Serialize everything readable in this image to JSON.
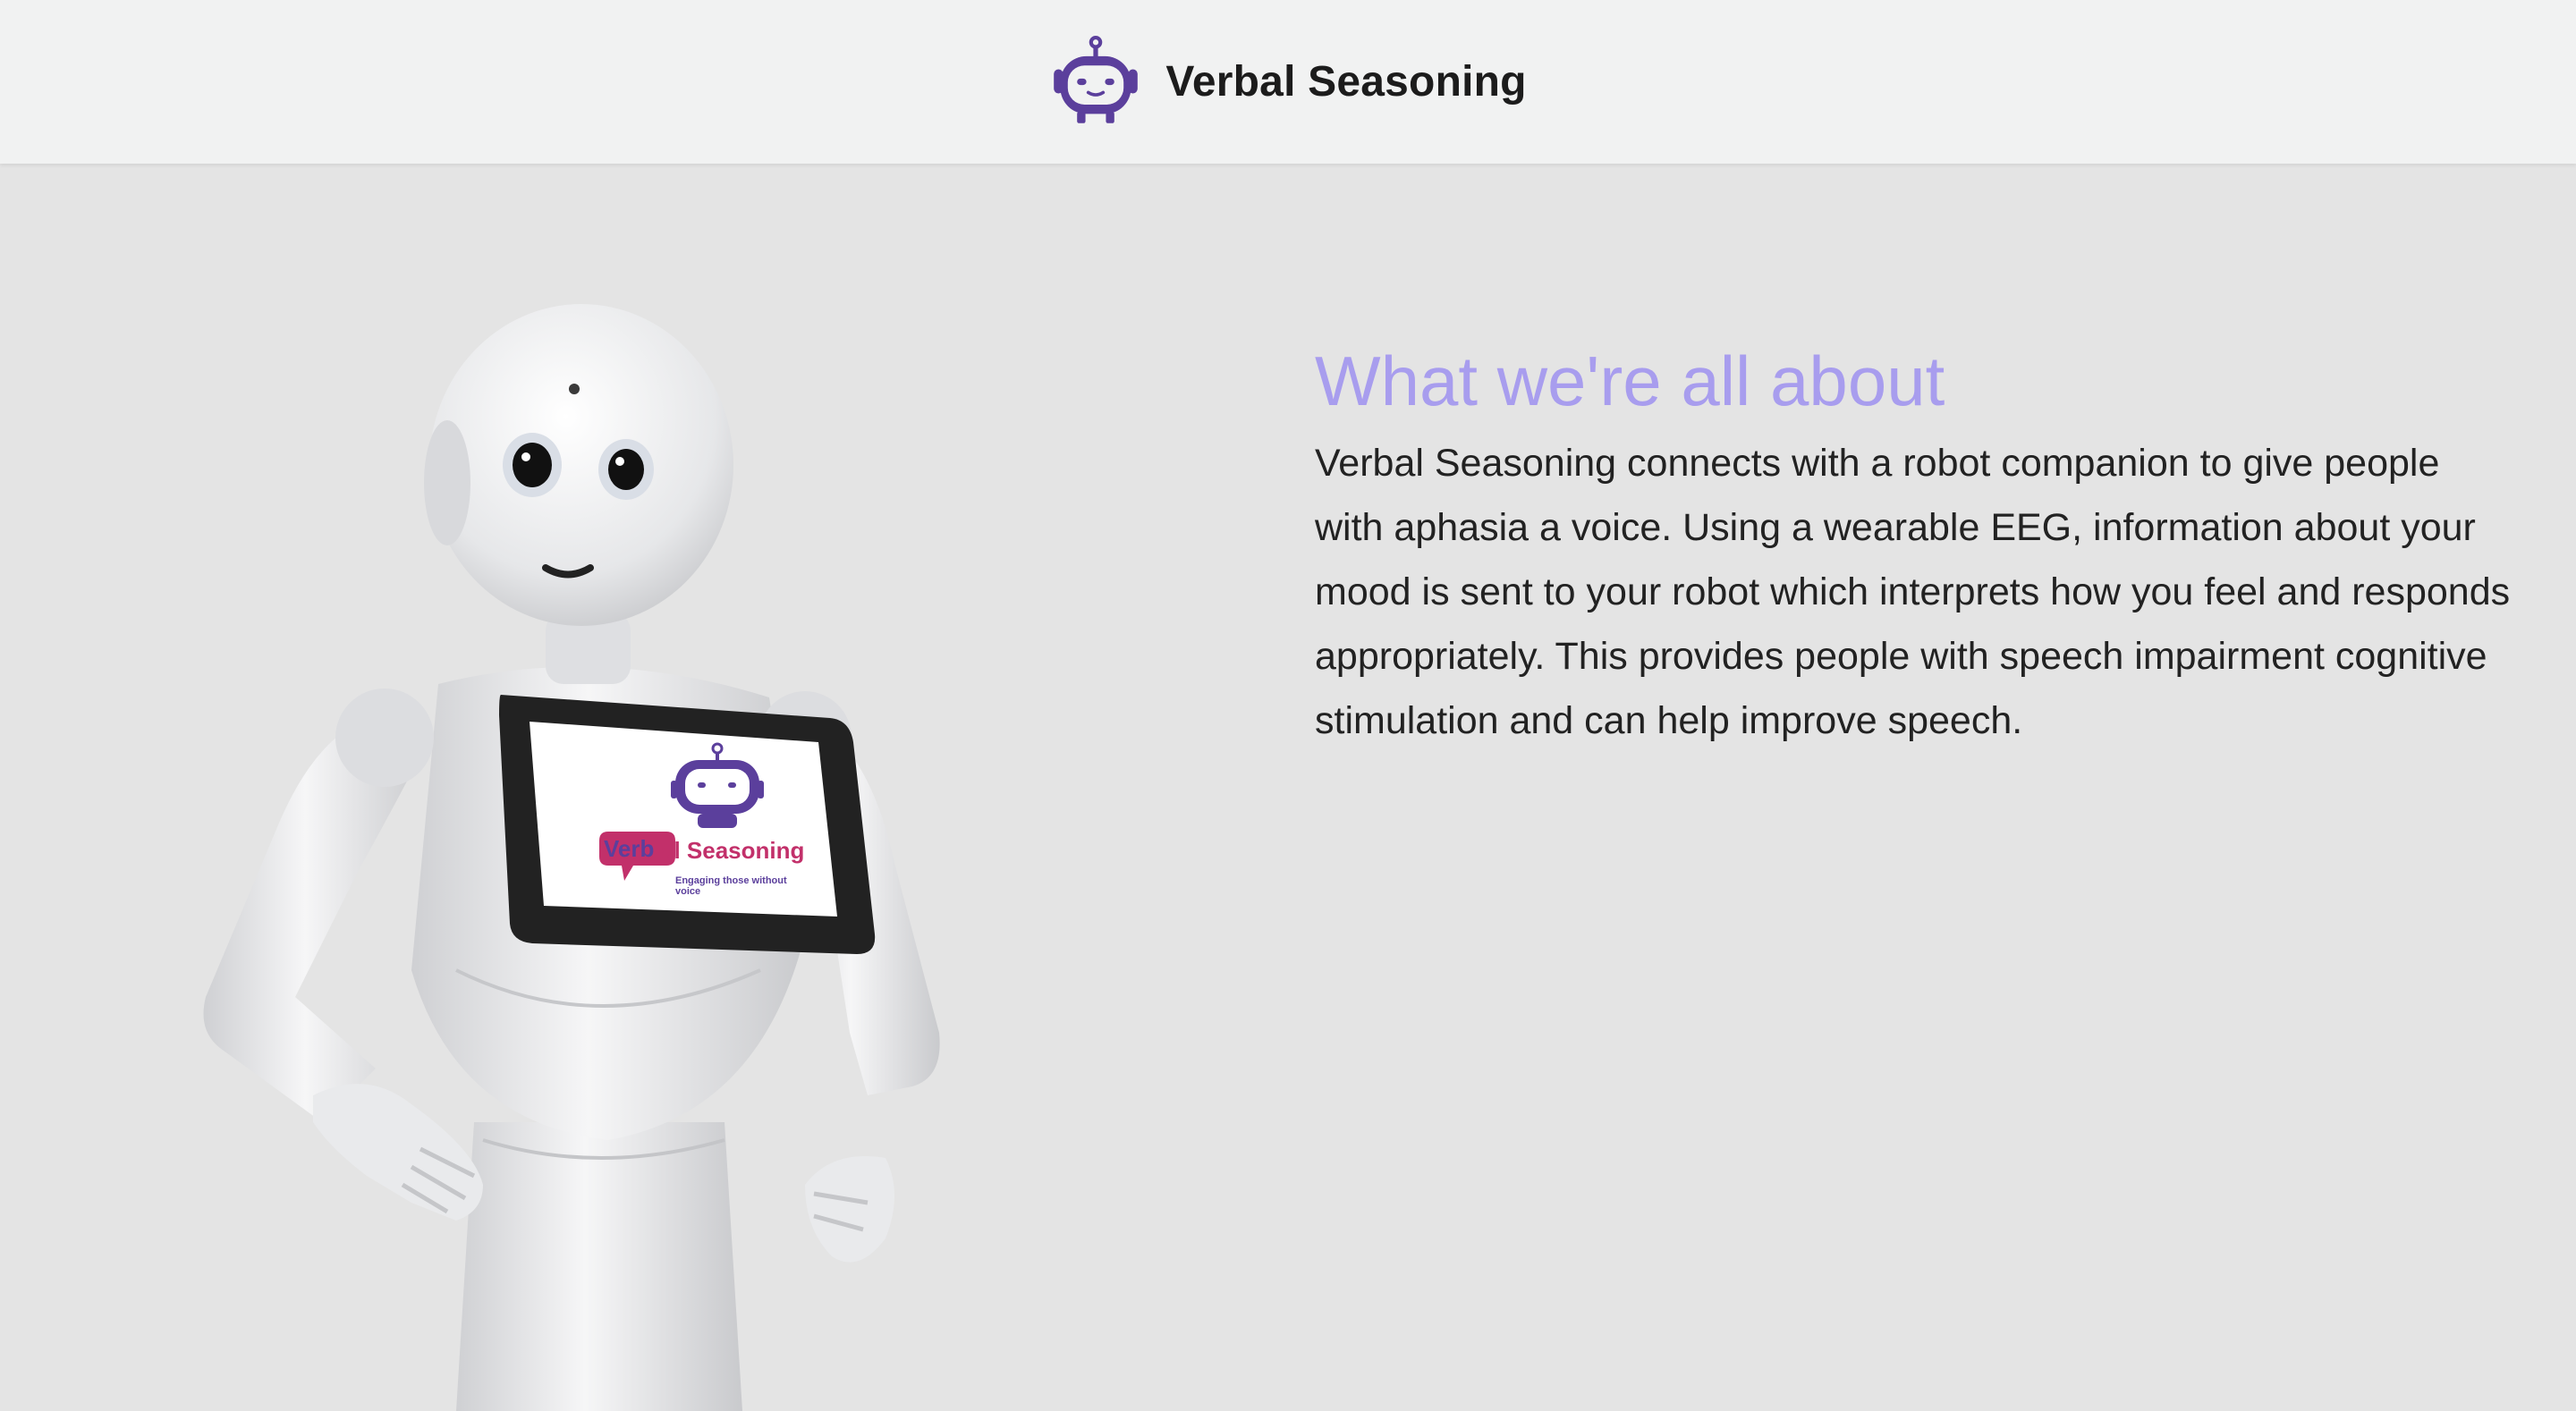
{
  "header": {
    "brand_name": "Verbal Seasoning",
    "logo_icon": "robot-icon",
    "logo_color": "#5b3f9c"
  },
  "hero": {
    "image": "pepper-robot-image",
    "screen": {
      "brand_prefix": "Verb",
      "brand_suffix": "al Seasoning",
      "tagline_line1": "Engaging those without",
      "tagline_line2": "voice"
    }
  },
  "about": {
    "title": "What we're all about",
    "body": "Verbal Seasoning connects with a robot companion to give people with aphasia a voice. Using a wearable EEG, information about your mood is sent to your robot which interprets how you feel and responds appropriately. This provides people with speech impairment cognitive stimulation and can help improve speech."
  },
  "colors": {
    "page_background": "#e4e4e4",
    "header_background": "#f1f2f2",
    "title_color": "#a89dee",
    "text_color": "#222222",
    "accent_pink": "#c2306a",
    "accent_purple": "#5b3f9c"
  }
}
